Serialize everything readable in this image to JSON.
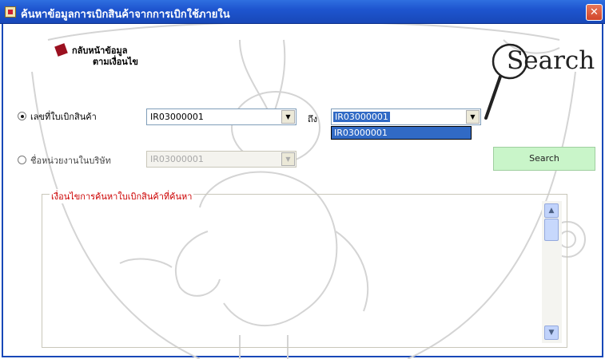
{
  "window": {
    "title": "ค้นหาข้อมูลการเบิกสินค้าจากการเบิกใช้ภายใน",
    "close_glyph": "✕"
  },
  "back_link": {
    "line1": "กลับหน้าข้อมูล",
    "line2": "ตามเงื่อนไข"
  },
  "search_logo": {
    "text": "Search"
  },
  "criteria": {
    "by_number": {
      "label": "เลขที่ใบเบิกสินค้า",
      "selected": true,
      "from_value": "IR03000001",
      "to_label": "ถึง",
      "to_value": "IR03000001",
      "dropdown_options": [
        "IR03000001"
      ]
    },
    "by_department": {
      "label": "ชื่อหน่วยงานในบริษัท",
      "selected": false,
      "value": "IR03000001"
    }
  },
  "search_button": {
    "label": "Search"
  },
  "results": {
    "legend": "เงื่อนไขการค้นหาใบเบิกสินค้าที่ค้นหา"
  },
  "icons": {
    "back": "book-icon",
    "logo": "magnifier-icon",
    "combo_arrow": "chevron-down-icon",
    "scroll_up": "chevron-up-icon",
    "scroll_down": "chevron-down-icon"
  },
  "colors": {
    "titlebar": "#1e55cf",
    "search_button_bg": "#c9f5c9",
    "legend_text": "#cc0000",
    "selection": "#316ac5"
  }
}
